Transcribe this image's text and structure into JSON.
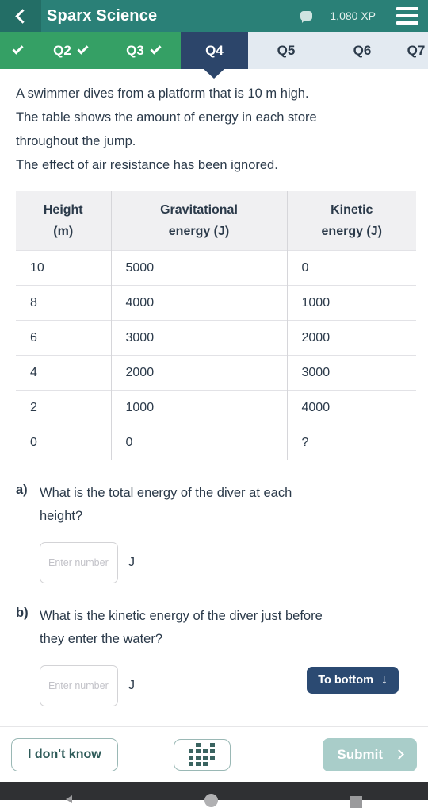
{
  "header": {
    "back_icon": "chevron-left-icon",
    "title": "Sparx Science",
    "chat_icon": "chat-bubble-icon",
    "xp": "1,080 XP",
    "menu_icon": "hamburger-menu-icon"
  },
  "tabs": [
    {
      "label": "",
      "state": "done",
      "tick": "✓"
    },
    {
      "label": "Q2",
      "state": "done",
      "tick": "✓"
    },
    {
      "label": "Q3",
      "state": "done",
      "tick": "✓"
    },
    {
      "label": "Q4",
      "state": "active",
      "tick": ""
    },
    {
      "label": "Q5",
      "state": "todo",
      "tick": ""
    },
    {
      "label": "Q6",
      "state": "todo",
      "tick": ""
    },
    {
      "label": "Q7",
      "state": "todo",
      "tick": ""
    }
  ],
  "question": {
    "stem_line1": "A swimmer dives from a platform that is 10 m high.",
    "stem_line2": "The table shows the amount of energy in each store",
    "stem_line3": "throughout the jump.",
    "stem_line4": "The effect of air resistance has been ignored."
  },
  "table": {
    "headers": [
      "Height\n(m)",
      "Gravitational\nenergy (J)",
      "Kinetic\nenergy (J)"
    ],
    "header_height_l1": "Height",
    "header_height_l2": "(m)",
    "header_grav_l1": "Gravitational",
    "header_grav_l2": "energy (J)",
    "header_kin_l1": "Kinetic",
    "header_kin_l2": "energy (J)",
    "rows": [
      {
        "height": "10",
        "gravitational": "5000",
        "kinetic": "0"
      },
      {
        "height": "8",
        "gravitational": "4000",
        "kinetic": "1000"
      },
      {
        "height": "6",
        "gravitational": "3000",
        "kinetic": "2000"
      },
      {
        "height": "4",
        "gravitational": "2000",
        "kinetic": "3000"
      },
      {
        "height": "2",
        "gravitational": "1000",
        "kinetic": "4000"
      },
      {
        "height": "0",
        "gravitational": "0",
        "kinetic": "?"
      }
    ]
  },
  "parts": {
    "a": {
      "label": "a)",
      "text_line1": "What is the total energy of the diver at each",
      "text_line2": "height?",
      "input_value": "",
      "input_placeholder": "Enter number",
      "unit": "J"
    },
    "b": {
      "label": "b)",
      "text_line1": "What is the kinetic energy of the diver just before",
      "text_line2": "they enter the water?",
      "input_value": "",
      "input_placeholder": "Enter number",
      "unit": "J",
      "to_bottom_label": "To bottom",
      "to_bottom_arrow": "↓"
    }
  },
  "footer": {
    "dont_know_label": "I don't know",
    "calculator_icon": "calculator-icon",
    "submit_label": "Submit",
    "submit_chevron": "chevron-right-icon"
  },
  "navbar": {
    "back_icon": "android-back-icon",
    "home_icon": "android-home-icon",
    "recents_icon": "android-recents-icon"
  },
  "colors": {
    "header_teal": "#2a8077",
    "tab_done_green": "#35a065",
    "tab_active_navy": "#2c456a",
    "tab_idle_grey": "#e3eaf1",
    "to_bottom_navy": "#2b4a72",
    "submit_disabled_teal": "#a9cdc9",
    "outline_teal": "#9ab8b5",
    "text_dark": "#2b3a4a"
  }
}
